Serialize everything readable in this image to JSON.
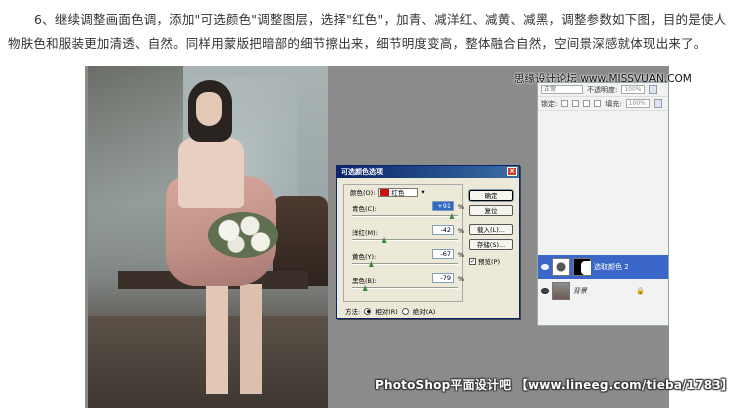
{
  "article": {
    "line1": "6、继续调整画面色调，添加\"可选颜色\"调整图层，选择\"红色\"，加青、减洋红、减黄、减黑，调整参数如下图，目的是使人",
    "line2": "物肤色和服装更加清透、自然。同样用蒙版把暗部的细节擦出来，细节明度变高，整体融合自然，空间景深感就体现出来了。"
  },
  "watermarks": {
    "site": "思缘设计论坛 www.MISSVUAN.COM",
    "bottom": "PhotoShop平面设计吧 【www.lineeg.com/tieba/1783】"
  },
  "layers_panel": {
    "blend_mode": "正常",
    "opacity_label": "不透明度:",
    "opacity_value": "100%",
    "lock_label": "锁定:",
    "fill_label": "填充:",
    "fill_value": "100%",
    "layers": [
      {
        "name": "选取颜色 2",
        "active": true
      },
      {
        "name": "背景",
        "active": false
      }
    ],
    "lock_glyph": "🔒"
  },
  "dialog": {
    "title": "可选颜色选项",
    "close": "×",
    "color_label": "颜色(O):",
    "color_value": "红色",
    "sliders": [
      {
        "label": "青色(C):",
        "value": "+91",
        "pct": "%",
        "fraction": 0.955
      },
      {
        "label": "洋红(M):",
        "value": "-42",
        "pct": "%",
        "fraction": 0.29
      },
      {
        "label": "黄色(Y):",
        "value": "-67",
        "pct": "%",
        "fraction": 0.165
      },
      {
        "label": "黑色(B):",
        "value": "-79",
        "pct": "%",
        "fraction": 0.105
      }
    ],
    "buttons": {
      "ok": "确定",
      "reset": "复位",
      "load": "载入(L)...",
      "save": "存储(S)..."
    },
    "preview_label": "预览(P)",
    "method_label": "方法:",
    "method_relative": "相对(R)",
    "method_absolute": "绝对(A)"
  }
}
